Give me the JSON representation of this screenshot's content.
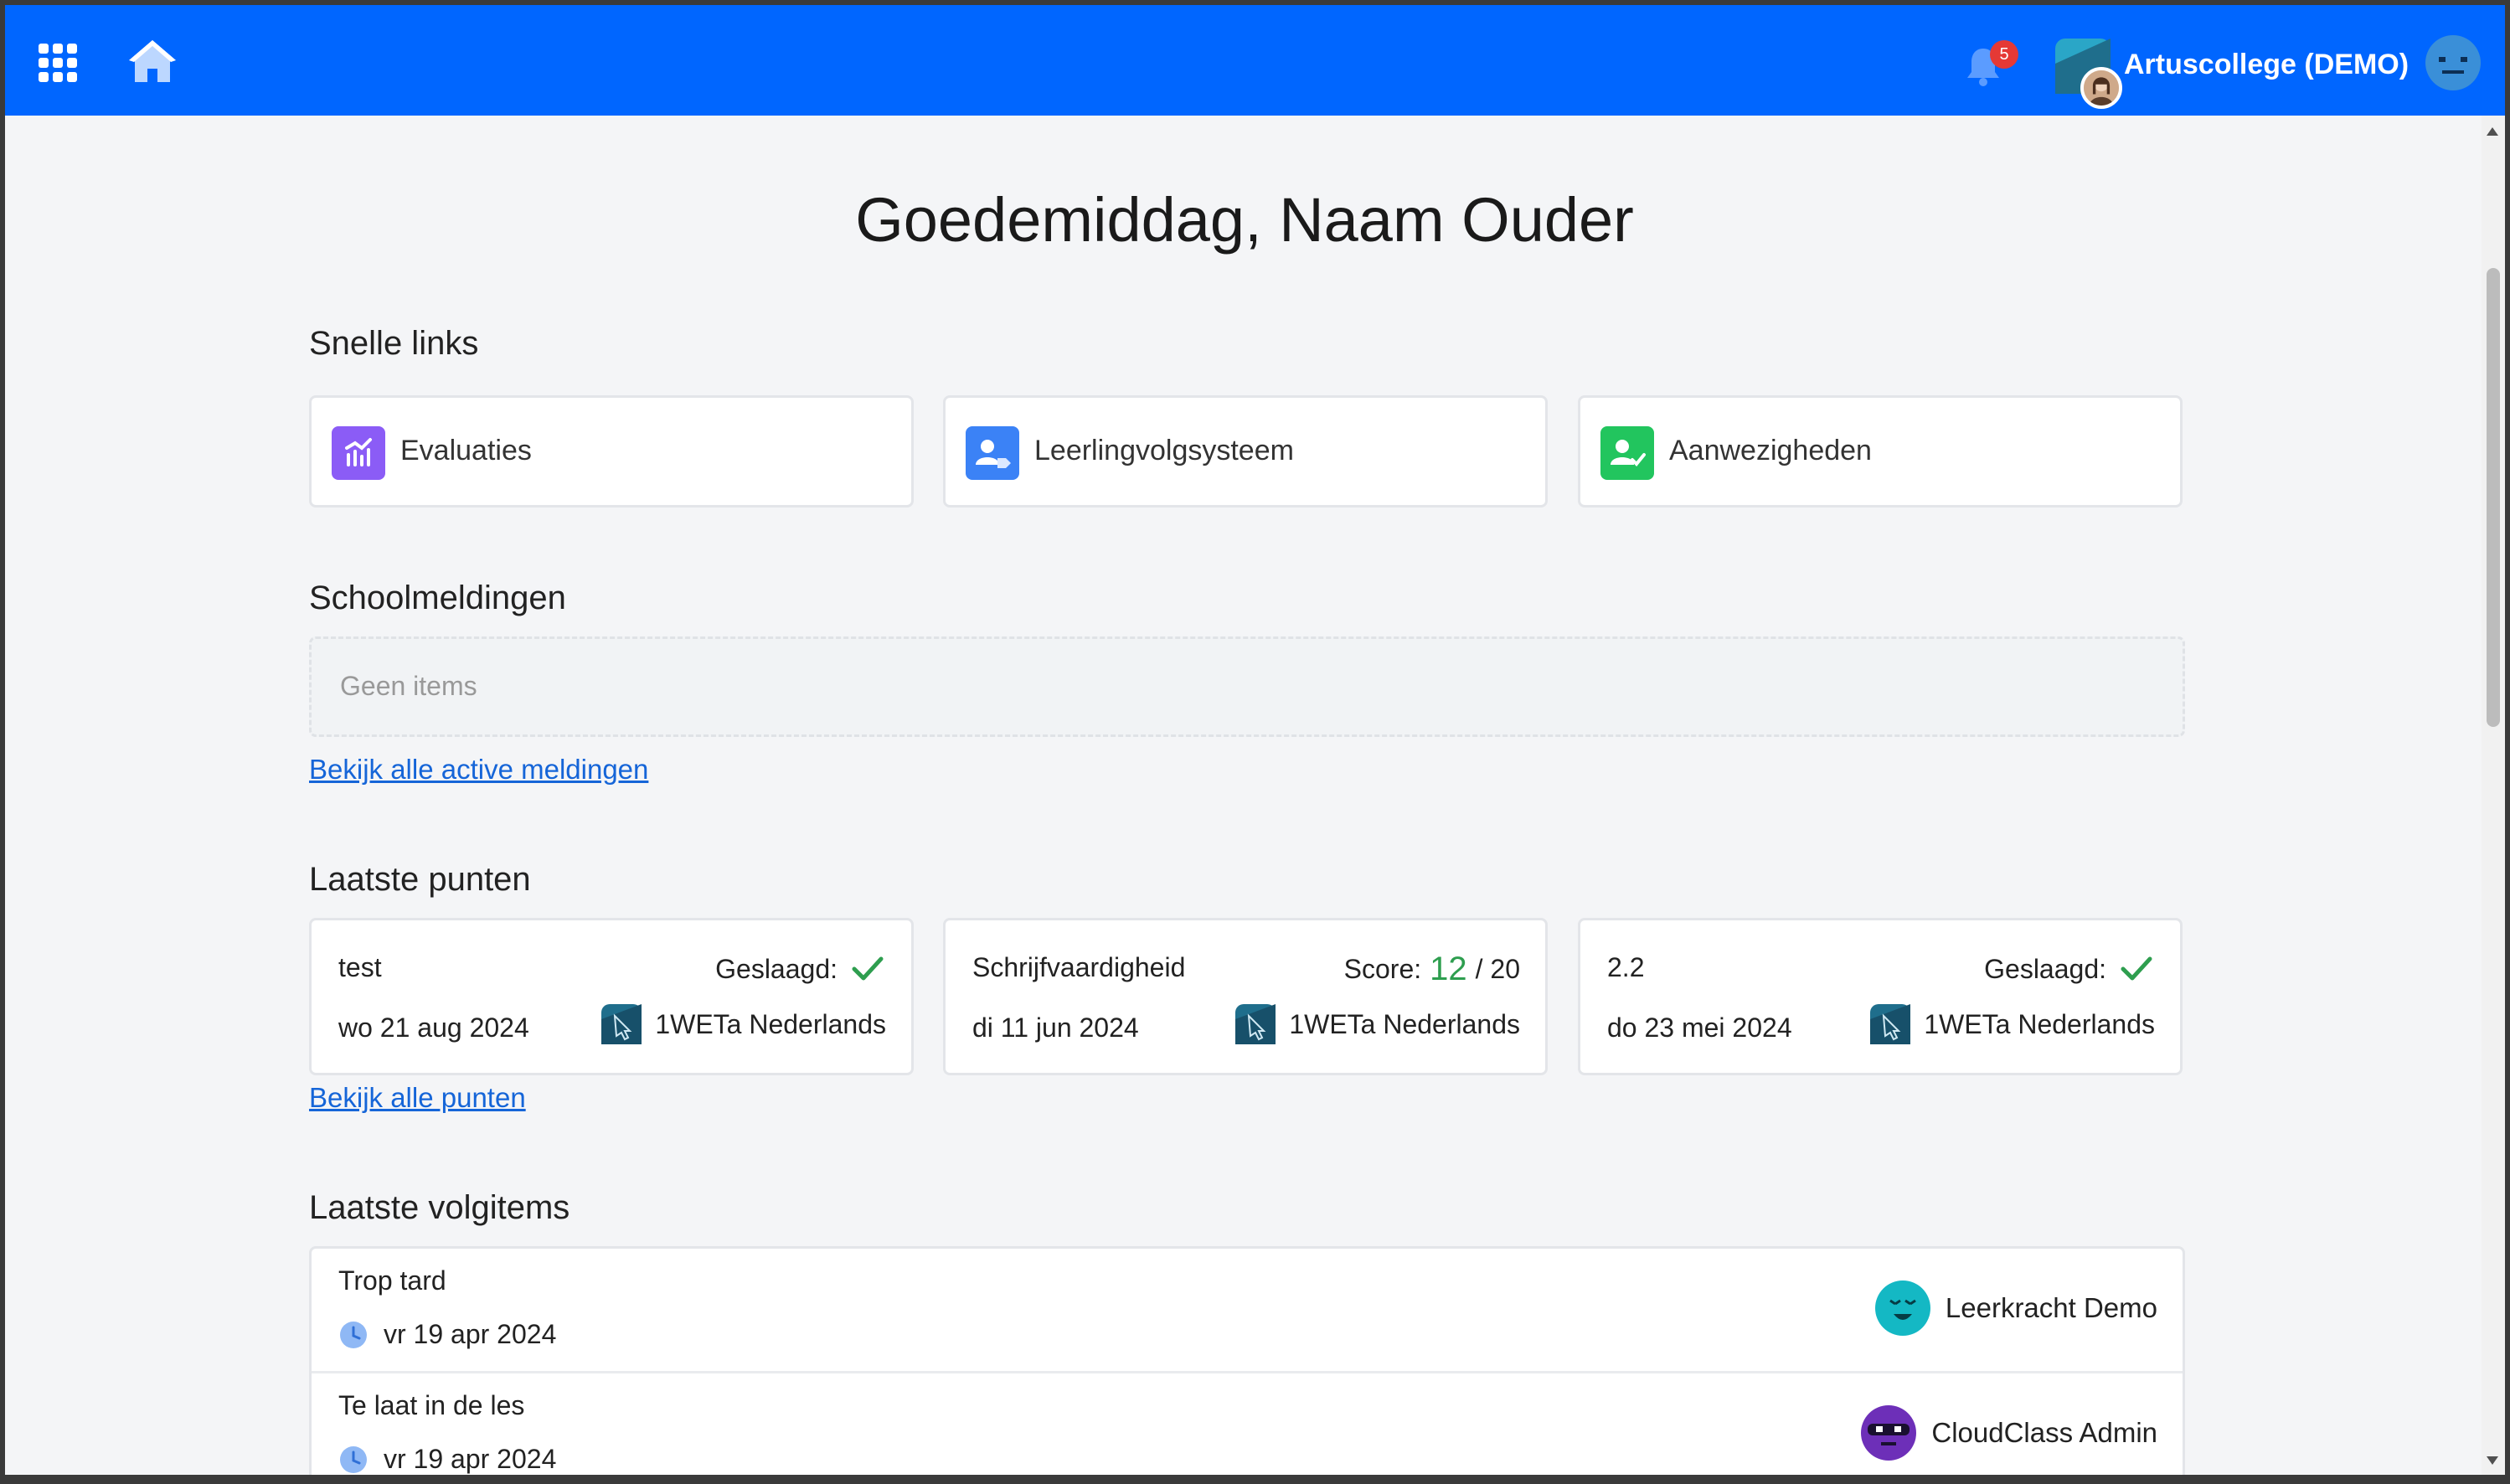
{
  "header": {
    "notification_count": "5",
    "school_name": "Artuscollege (DEMO)"
  },
  "greeting": "Goedemiddag, Naam Ouder",
  "quick_links": {
    "title": "Snelle links",
    "items": [
      {
        "label": "Evaluaties",
        "icon": "chart-icon",
        "color": "#8b5cf6"
      },
      {
        "label": "Leerlingvolgsysteem",
        "icon": "student-tag-icon",
        "color": "#3b82f6"
      },
      {
        "label": "Aanwezigheden",
        "icon": "user-check-icon",
        "color": "#22c55e"
      }
    ]
  },
  "school_notifications": {
    "title": "Schoolmeldingen",
    "empty_text": "Geen items",
    "link": "Bekijk alle active meldingen"
  },
  "latest_points": {
    "title": "Laatste punten",
    "items": [
      {
        "title": "test",
        "status_label": "Geslaagd:",
        "date": "wo 21 aug 2024",
        "course": "1WETa Nederlands"
      },
      {
        "title": "Schrijfvaardigheid",
        "status_label": "Score:",
        "score": "12",
        "score_max": "/ 20",
        "date": "di 11 jun 2024",
        "course": "1WETa Nederlands"
      },
      {
        "title": "2.2",
        "status_label": "Geslaagd:",
        "date": "do 23 mei 2024",
        "course": "1WETa Nederlands"
      }
    ],
    "link": "Bekijk alle punten"
  },
  "latest_follow_items": {
    "title": "Laatste volgitems",
    "items": [
      {
        "title": "Trop tard",
        "date": "vr 19 apr 2024",
        "author": "Leerkracht Demo",
        "avatar_color": "#14b8c4"
      },
      {
        "title": "Te laat in de les",
        "date": "vr 19 apr 2024",
        "author": "CloudClass Admin",
        "avatar_color": "#6d2fb8"
      }
    ]
  },
  "colors": {
    "topbar": "#0066ff",
    "success": "#2e9e4f",
    "link": "#1565d8"
  }
}
